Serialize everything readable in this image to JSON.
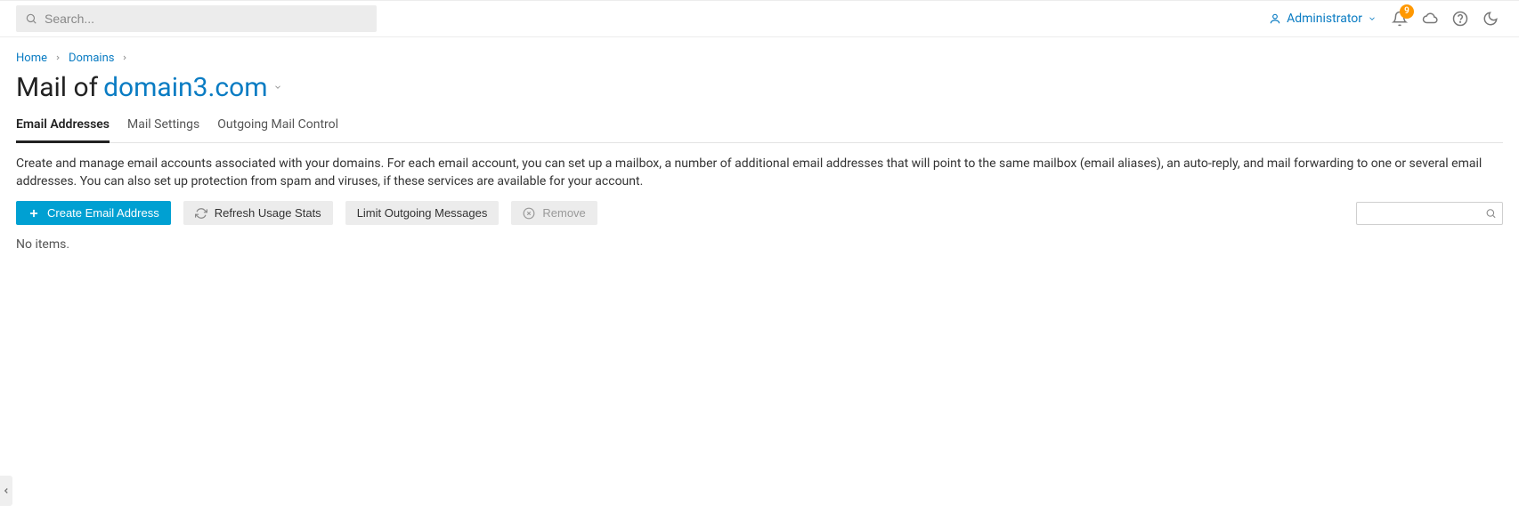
{
  "topbar": {
    "search_placeholder": "Search...",
    "user_label": "Administrator",
    "notification_count": "9"
  },
  "breadcrumbs": {
    "home": "Home",
    "domains": "Domains"
  },
  "title": {
    "prefix": "Mail of ",
    "domain": "domain3.com"
  },
  "tabs": {
    "email_addresses": "Email Addresses",
    "mail_settings": "Mail Settings",
    "outgoing_control": "Outgoing Mail Control"
  },
  "description": "Create and manage email accounts associated with your domains. For each email account, you can set up a mailbox, a number of additional email addresses that will point to the same mailbox (email aliases), an auto-reply, and mail forwarding to one or several email addresses. You can also set up protection from spam and viruses, if these services are available for your account.",
  "toolbar": {
    "create": "Create Email Address",
    "refresh": "Refresh Usage Stats",
    "limit": "Limit Outgoing Messages",
    "remove": "Remove"
  },
  "empty_text": "No items."
}
